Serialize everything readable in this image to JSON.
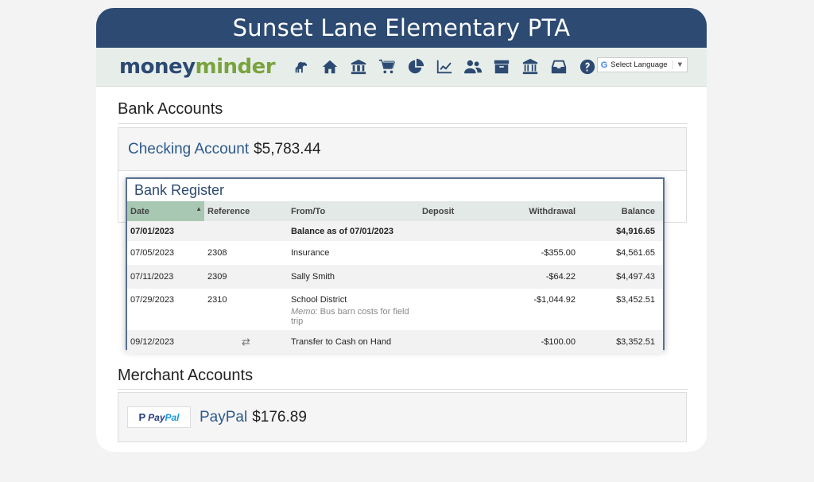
{
  "banner": {
    "title": "Sunset Lane Elementary PTA"
  },
  "nav": {
    "logo_part1": "money",
    "logo_part2": "minder",
    "icons": [
      "horse-icon",
      "home-icon",
      "bank-icon",
      "cart-icon",
      "pie-chart-icon",
      "line-chart-icon",
      "users-icon",
      "archive-icon",
      "institution-icon",
      "inbox-icon",
      "help-icon"
    ],
    "language_label": "Select Language",
    "language_arrow": "▼",
    "google_g": "G"
  },
  "bank_accounts": {
    "title": "Bank Accounts",
    "account_name": "Checking Account",
    "account_balance": "$5,783.44"
  },
  "register": {
    "title": "Bank Register",
    "columns": [
      "Date",
      "Reference",
      "From/To",
      "Deposit",
      "Withdrawal",
      "Balance"
    ],
    "sort_indicator": "▲",
    "rows": [
      {
        "date": "07/01/2023",
        "reference": "",
        "from_to": "Balance as of 07/01/2023",
        "deposit": "",
        "withdrawal": "",
        "balance": "$4,916.65"
      },
      {
        "date": "07/05/2023",
        "reference": "2308",
        "from_to": "Insurance",
        "deposit": "",
        "withdrawal": "-$355.00",
        "balance": "$4,561.65"
      },
      {
        "date": "07/11/2023",
        "reference": "2309",
        "from_to": "Sally Smith",
        "deposit": "",
        "withdrawal": "-$64.22",
        "balance": "$4,497.43"
      },
      {
        "date": "07/29/2023",
        "reference": "2310",
        "from_to": "School District",
        "memo_label": "Memo:",
        "memo_text": " Bus barn costs for field trip",
        "deposit": "",
        "withdrawal": "-$1,044.92",
        "balance": "$3,452.51"
      },
      {
        "date": "09/12/2023",
        "reference": "⇄",
        "from_to": "Transfer to Cash on Hand",
        "deposit": "",
        "withdrawal": "-$100.00",
        "balance": "$3,352.51"
      }
    ]
  },
  "merchant_accounts": {
    "title": "Merchant Accounts",
    "badge_mark": "P",
    "badge_text1": "Pay",
    "badge_text2": "Pal",
    "account_name": "PayPal",
    "account_balance": "$176.89"
  },
  "colors": {
    "banner": "#2c4a72",
    "navbar": "#e7eeea",
    "link": "#2c5a8c",
    "sorted_header": "#a8c8b4"
  }
}
